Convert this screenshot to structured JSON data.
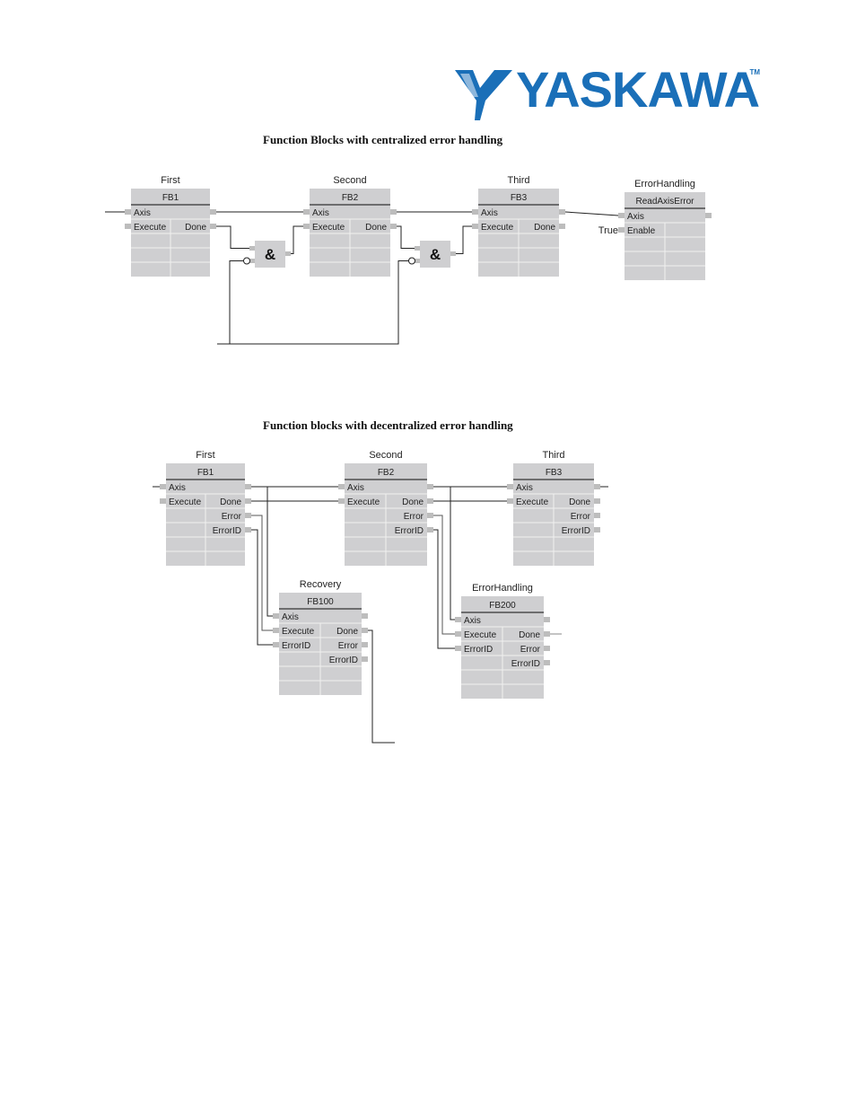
{
  "brand": {
    "name": "YASKAWA",
    "trademark": "TM",
    "color": "#1a6fb8"
  },
  "centralized": {
    "title": "Function Blocks with centralized error handling",
    "blocks": [
      {
        "instance": "First",
        "type": "FB1",
        "inputs": [
          "Axis",
          "Execute"
        ],
        "outputs": [
          "Done"
        ]
      },
      {
        "instance": "Second",
        "type": "FB2",
        "inputs": [
          "Axis",
          "Execute"
        ],
        "outputs": [
          "Done"
        ]
      },
      {
        "instance": "Third",
        "type": "FB3",
        "inputs": [
          "Axis",
          "Execute"
        ],
        "outputs": [
          "Done"
        ]
      },
      {
        "instance": "ErrorHandling",
        "type": "ReadAxisError",
        "inputs": [
          "Axis",
          "Enable"
        ],
        "outputs": []
      }
    ],
    "gates": [
      {
        "symbol": "&"
      },
      {
        "symbol": "&"
      }
    ],
    "constant": "True"
  },
  "decentralized": {
    "title": "Function blocks with decentralized error handling",
    "blocks": [
      {
        "instance": "First",
        "type": "FB1",
        "inputs": [
          "Axis",
          "Execute"
        ],
        "outputs": [
          "Done",
          "Error",
          "ErrorID"
        ]
      },
      {
        "instance": "Second",
        "type": "FB2",
        "inputs": [
          "Axis",
          "Execute"
        ],
        "outputs": [
          "Done",
          "Error",
          "ErrorID"
        ]
      },
      {
        "instance": "Third",
        "type": "FB3",
        "inputs": [
          "Axis",
          "Execute"
        ],
        "outputs": [
          "Done",
          "Error",
          "ErrorID"
        ]
      },
      {
        "instance": "Recovery",
        "type": "FB100",
        "inputs": [
          "Axis",
          "Execute",
          "ErrorID"
        ],
        "outputs": [
          "Done",
          "Error",
          "ErrorID"
        ]
      },
      {
        "instance": "ErrorHandling",
        "type": "FB200",
        "inputs": [
          "Axis",
          "Execute",
          "ErrorID"
        ],
        "outputs": [
          "Done",
          "Error",
          "ErrorID"
        ]
      }
    ]
  }
}
